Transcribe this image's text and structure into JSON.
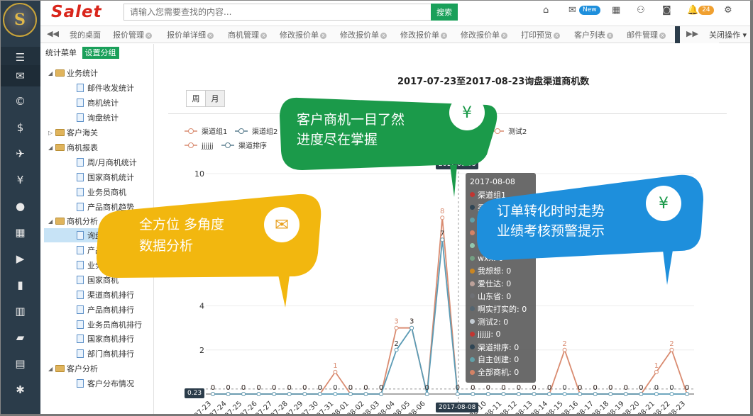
{
  "header": {
    "brand": "Salet",
    "search_placeholder": "请输入您需要查找的内容...",
    "search_button": "搜索",
    "new_badge": "New",
    "notification_count": "24",
    "accent": "#1aa05a",
    "brand_color": "#d9251b"
  },
  "rail": {
    "logo_letter": "S",
    "icons": [
      "menu-icon",
      "mail-icon",
      "copyright-icon",
      "dollar-icon",
      "plane-icon",
      "yen-icon",
      "user-icon",
      "grid-icon",
      "play-icon",
      "book-icon",
      "bar-chart-icon",
      "folder-icon",
      "list-icon",
      "settings-icon"
    ]
  },
  "tabs": [
    {
      "label": "我的桌面"
    },
    {
      "label": "报价管理"
    },
    {
      "label": "报价单详细"
    },
    {
      "label": "商机管理"
    },
    {
      "label": "修改报价单"
    },
    {
      "label": "修改报价单"
    },
    {
      "label": "修改报价单"
    },
    {
      "label": "修改报价单"
    },
    {
      "label": "打印预览"
    },
    {
      "label": "客户列表"
    },
    {
      "label": "邮件管理"
    }
  ],
  "tabbar": {
    "close_ops": "关闭操作"
  },
  "sidebar": {
    "menu_label": "统计菜单",
    "setup_group": "设置分组",
    "tree": [
      {
        "label": "业务统计"
      },
      {
        "label": "邮件收发统计"
      },
      {
        "label": "商机统计"
      },
      {
        "label": "询盘统计"
      },
      {
        "label": "客户海关"
      },
      {
        "label": "商机报表"
      },
      {
        "label": "周/月商机统计"
      },
      {
        "label": "国家商机统计"
      },
      {
        "label": "业务员商机"
      },
      {
        "label": "产品商机趋势"
      },
      {
        "label": "商机分析"
      },
      {
        "label": "询盘渠道商机数"
      },
      {
        "label": "产品商机数"
      },
      {
        "label": "业务员商机数"
      },
      {
        "label": "国家商机"
      },
      {
        "label": "渠道商机排行"
      },
      {
        "label": "产品商机排行"
      },
      {
        "label": "业务员商机排行"
      },
      {
        "label": "国家商机排行"
      },
      {
        "label": "部门商机排行"
      },
      {
        "label": "客户分析"
      },
      {
        "label": "客户分布情况"
      }
    ]
  },
  "main": {
    "week": "周",
    "month": "月"
  },
  "chart_data": {
    "type": "line",
    "title": "2017-07-23至2017-08-23询盘渠道商机数",
    "x": [
      "07-23",
      "07-24",
      "07-25",
      "07-26",
      "07-27",
      "07-28",
      "07-29",
      "07-30",
      "07-31",
      "08-01",
      "08-02",
      "08-03",
      "08-04",
      "08-05",
      "08-06",
      "08-07",
      "08-08",
      "08-09",
      "08-10",
      "08-11",
      "08-12",
      "08-13",
      "08-14",
      "08-15",
      "08-16",
      "08-17",
      "08-18",
      "08-19",
      "08-20",
      "08-21",
      "08-22",
      "08-23"
    ],
    "x_visible_labels": [
      "07-23",
      "07-24",
      "07-25",
      "07-26",
      "07-27",
      "07-28",
      "07-29",
      "07-30",
      "07-31",
      "08-01",
      "08-02",
      "08-03",
      "08-04",
      "08-05",
      "08-06",
      "",
      "",
      "08-10",
      "08-11",
      "08-12",
      "08-13",
      "08-14",
      "08-15",
      "08-16",
      "08-17",
      "08-18",
      "08-19",
      "08-20",
      "08-21",
      "08-22",
      "08-23"
    ],
    "ylim": [
      0,
      10
    ],
    "yticks": [
      {
        "v": 2,
        "label": "2"
      },
      {
        "v": 4,
        "label": "4"
      },
      {
        "v": 10,
        "label": "10"
      }
    ],
    "legend_row1": [
      "渠道组1",
      "渠道组2",
      "我想想",
      "爱仕达",
      "山东省",
      "啊实打实的",
      "测试2"
    ],
    "legend_row2": [
      "jjjjjj",
      "渠道排序"
    ],
    "series": [
      {
        "name": "全部商机",
        "color": "#d98b70",
        "values": [
          0,
          0,
          0,
          0,
          0,
          0,
          0,
          0,
          1,
          0,
          0,
          0,
          3,
          3,
          0,
          8,
          0,
          0,
          0,
          0,
          0,
          0,
          0,
          2,
          0,
          0,
          0,
          0,
          0,
          1,
          2,
          0
        ]
      },
      {
        "name": "渠道组1",
        "color": "#5b9bb5",
        "values": [
          0,
          0,
          0,
          0,
          0,
          0,
          0,
          0,
          0,
          0,
          0,
          0,
          2,
          3,
          0,
          7,
          0,
          0,
          0,
          0,
          0,
          0,
          0,
          0,
          0,
          0,
          0,
          0,
          0,
          0,
          0,
          0
        ]
      }
    ],
    "crosshair_y_label": "0.23",
    "crosshair_x_label": "2017-08-08",
    "crosshair_top_label": "2017-08-08",
    "tooltip": {
      "title": "2017-08-08",
      "rows": [
        {
          "label": "渠道组1",
          "color": "#c23531"
        },
        {
          "label": "渠道组2",
          "color": "#2f4554"
        },
        {
          "label": "jjjjjj",
          "color": "#61a0a8"
        },
        {
          "label": "渠道排序",
          "color": "#d48265"
        },
        {
          "label": "自主创建",
          "color": "#91c7ae"
        },
        {
          "label": "wxx: 0",
          "color": "#749f83"
        },
        {
          "label": "我想想: 0",
          "color": "#ca8622"
        },
        {
          "label": "爱仕达: 0",
          "color": "#bda29a"
        },
        {
          "label": "山东省: 0",
          "color": "#6e7074"
        },
        {
          "label": "啊实打实的: 0",
          "color": "#546570"
        },
        {
          "label": "测试2: 0",
          "color": "#c4ccd3"
        },
        {
          "label": "jjjjjj: 0",
          "color": "#c23531"
        },
        {
          "label": "渠道排序: 0",
          "color": "#2f4554"
        },
        {
          "label": "自主创建: 0",
          "color": "#61a0a8"
        },
        {
          "label": "全部商机: 0",
          "color": "#d48265"
        }
      ]
    }
  },
  "bubbles": {
    "green": {
      "line1": "客户商机一目了然",
      "line2": "进度尽在掌握",
      "color": "#1b9a4a",
      "icon": "yen-hand-icon"
    },
    "yellow": {
      "line1": "全方位 多角度",
      "line2": "数据分析",
      "color": "#f2b70f",
      "icon": "mail-icon"
    },
    "blue": {
      "line1": "订单转化时时走势",
      "line2": "业绩考核预警提示",
      "color": "#1e8fdc",
      "icon": "yen-hand-icon"
    }
  }
}
